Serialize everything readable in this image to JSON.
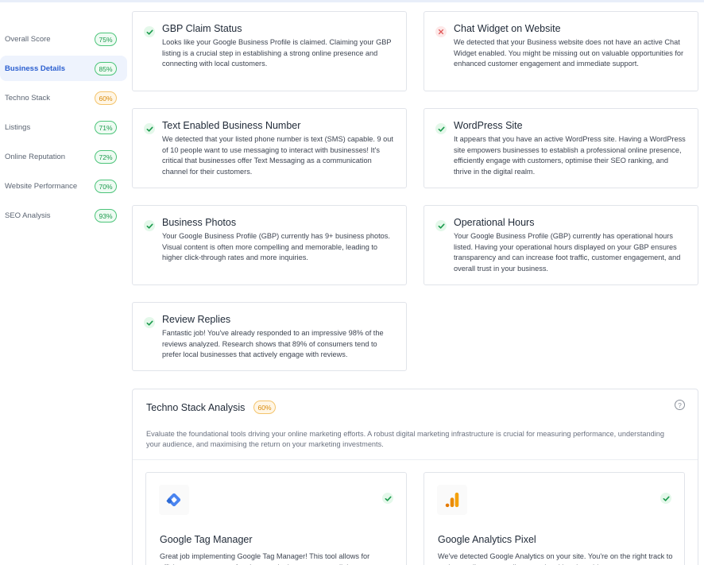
{
  "sidebar": {
    "items": [
      {
        "label": "Overall Score",
        "score": "75%",
        "tone": "green",
        "active": false
      },
      {
        "label": "Business Details",
        "score": "85%",
        "tone": "green",
        "active": true
      },
      {
        "label": "Techno Stack",
        "score": "60%",
        "tone": "orange",
        "active": false
      },
      {
        "label": "Listings",
        "score": "71%",
        "tone": "green",
        "active": false
      },
      {
        "label": "Online Reputation",
        "score": "72%",
        "tone": "green",
        "active": false
      },
      {
        "label": "Website Performance",
        "score": "70%",
        "tone": "green",
        "active": false
      },
      {
        "label": "SEO Analysis",
        "score": "93%",
        "tone": "green",
        "active": false
      }
    ]
  },
  "checks": {
    "gbp_claim": {
      "title": "GBP Claim Status",
      "status": "pass",
      "description": "Looks like your Google Business Profile is claimed. Claiming your GBP listing is a crucial step in establishing a strong online presence and connecting with local customers."
    },
    "chat_widget": {
      "title": "Chat Widget on Website",
      "status": "fail",
      "description": "We detected that your Business website does not have an active Chat Widget enabled. You might be missing out on valuable opportunities for enhanced customer engagement and immediate support."
    },
    "text_number": {
      "title": "Text Enabled Business Number",
      "status": "pass",
      "description": "We detected that your listed phone number is text (SMS) capable. 9 out of 10 people want to use messaging to interact with businesses! It's critical that businesses offer Text Messaging as a communication channel for their customers."
    },
    "wordpress": {
      "title": "WordPress Site",
      "status": "pass",
      "description": "It appears that you have an active WordPress site. Having a WordPress site empowers businesses to establish a professional online presence, efficiently engage with customers, optimise their SEO ranking, and thrive in the digital realm."
    },
    "photos": {
      "title": "Business Photos",
      "status": "pass",
      "description": "Your Google Business Profile (GBP) currently has 9+ business photos. Visual content is often more compelling and memorable, leading to higher click-through rates and more inquiries."
    },
    "hours": {
      "title": "Operational Hours",
      "status": "pass",
      "description": "Your Google Business Profile (GBP) currently has operational hours listed. Having your operational hours displayed on your GBP ensures transparency and can increase foot traffic, customer engagement, and overall trust in your business."
    },
    "reviews": {
      "title": "Review Replies",
      "status": "pass",
      "description": "Fantastic job! You've already responded to an impressive 98% of the reviews analyzed. Research shows that 89% of consumers tend to prefer local businesses that actively engage with reviews."
    }
  },
  "techno": {
    "title": "Techno Stack Analysis",
    "score": "60%",
    "help_icon": "?",
    "description": "Evaluate the foundational tools driving your online marketing efforts. A robust digital marketing infrastructure is crucial for measuring performance, understanding your audience, and maximising the return on your marketing investments.",
    "tools": [
      {
        "name": "Google Tag Manager",
        "icon": "google-tag-manager-logo",
        "description": "Great job implementing Google Tag Manager! This tool allows for efficient management of various marketing tags, streamlining your"
      },
      {
        "name": "Google Analytics Pixel",
        "icon": "google-analytics-logo",
        "description": "We've detected Google Analytics on your site. You're on the right track to understanding your audience and making data-driven"
      }
    ]
  },
  "colors": {
    "accent_blue": "#2b5fd0",
    "success_green": "#1a9a4c",
    "warning_orange": "#d98a0a",
    "error_red": "#e05252"
  }
}
